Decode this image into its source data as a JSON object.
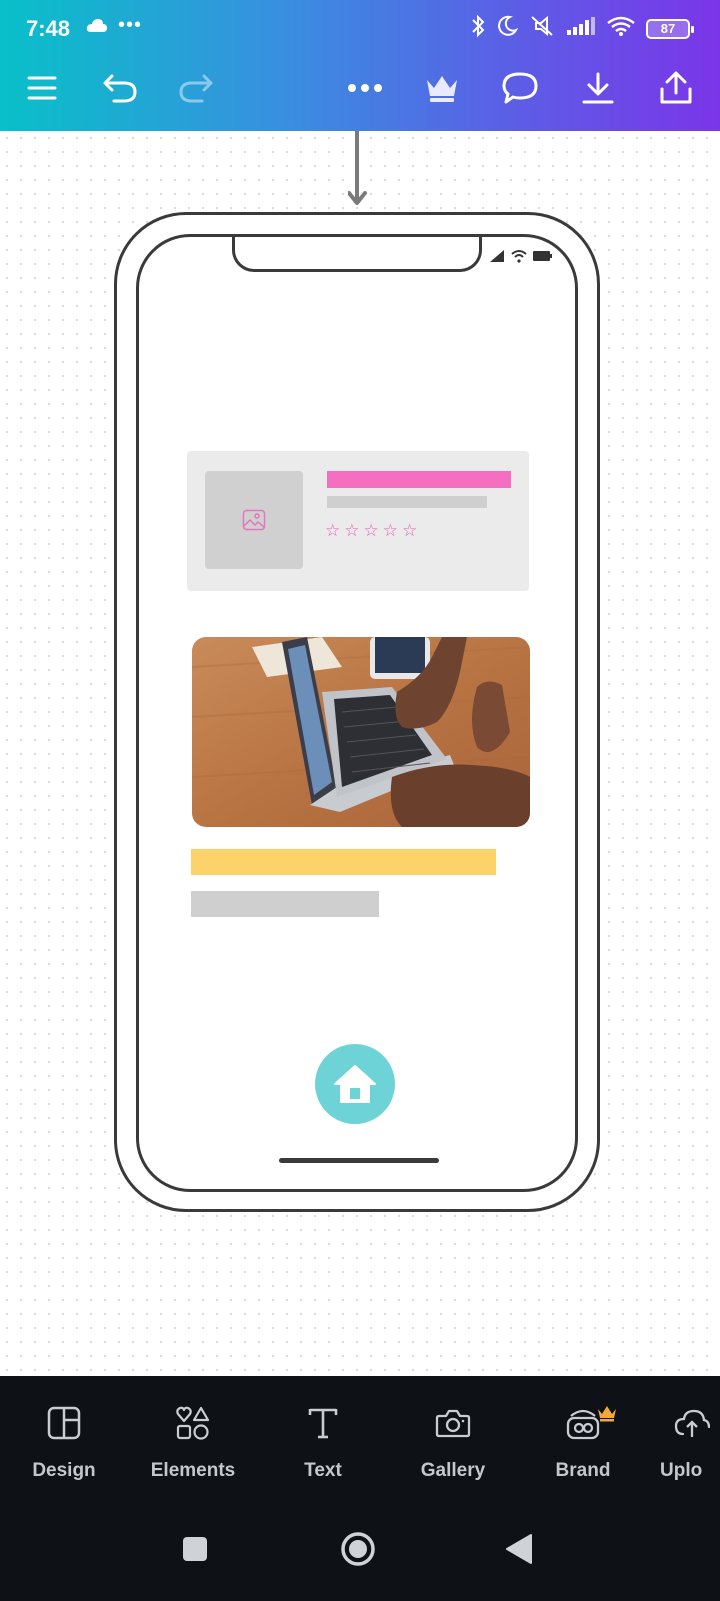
{
  "status": {
    "time": "7:48",
    "dots": "•••",
    "battery": "87"
  },
  "toolbar": {
    "menu": "menu-icon",
    "undo": "undo-icon",
    "redo": "redo-icon",
    "more": "more-icon",
    "premium": "crown-icon",
    "comment": "comment-icon",
    "download": "download-icon",
    "share": "share-icon"
  },
  "colors": {
    "accent_pink": "#f46fbf",
    "accent_yellow": "#fcd26b",
    "accent_teal": "#6dd3d7",
    "bottombar": "#0e1116"
  },
  "design": {
    "card": {
      "rating_stars": [
        "☆",
        "☆",
        "☆",
        "☆",
        "☆"
      ]
    }
  },
  "bottom_tools": [
    {
      "label": "Design",
      "icon": "layout-icon"
    },
    {
      "label": "Elements",
      "icon": "shapes-icon"
    },
    {
      "label": "Text",
      "icon": "text-icon"
    },
    {
      "label": "Gallery",
      "icon": "camera-icon"
    },
    {
      "label": "Brand",
      "icon": "brand-icon"
    },
    {
      "label": "Uplo",
      "icon": "upload-icon"
    }
  ],
  "nav": {
    "recents": "square-icon",
    "home": "circle-icon",
    "back": "triangle-back-icon"
  }
}
